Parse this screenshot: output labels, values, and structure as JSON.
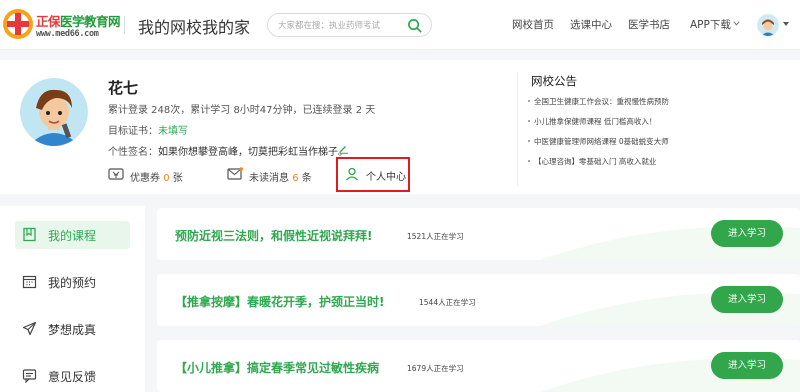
{
  "header": {
    "logo_brand_a": "正保",
    "logo_brand_b": "医学教育网",
    "logo_url": "www.med66.com",
    "site_title": "我的网校我的家",
    "search_placeholder": "大家都在搜：执业药师考试",
    "nav": [
      "网校首页",
      "选课中心",
      "医学书店",
      "APP下载"
    ]
  },
  "profile": {
    "name": "花七",
    "stats": "累计登录 248次，累计学习 8小时47分钟，已连续登录 2 天",
    "goal_label": "目标证书：",
    "goal_value": "未填写",
    "sign_label": "个性签名：",
    "sign_value": "如果你想攀登高峰，切莫把彩虹当作梯子。",
    "coupon_label": "优惠券",
    "coupon_count": "0",
    "coupon_unit": "张",
    "unread_label": "未读消息",
    "unread_count": "6",
    "unread_unit": "条",
    "user_center": "个人中心"
  },
  "notice": {
    "title": "网校公告",
    "items": [
      "全国卫生健康工作会议：重视慢性病预防",
      "小儿推拿保健师课程 低门槛高收入！",
      "中医健康管理师网络课程 0基础蜕变大师",
      "【心理咨询】零基础入门 高收入就业"
    ]
  },
  "sidebar": {
    "items": [
      {
        "label": "我的课程",
        "icon": "bookmark-icon"
      },
      {
        "label": "我的预约",
        "icon": "calendar-icon"
      },
      {
        "label": "梦想成真",
        "icon": "paper-plane-icon"
      },
      {
        "label": "意见反馈",
        "icon": "feedback-icon"
      }
    ]
  },
  "courses": [
    {
      "title": "预防近视三法则，和假性近视说拜拜!",
      "learners": "1521人正在学习",
      "button": "进入学习"
    },
    {
      "title": "【推拿按摩】春暖花开季，护颈正当时!",
      "learners": "1544人正在学习",
      "button": "进入学习"
    },
    {
      "title": "【小儿推拿】搞定春季常见过敏性疾病",
      "learners": "1679人正在学习",
      "button": "进入学习"
    }
  ],
  "colors": {
    "accent": "#31a64a",
    "highlight_box": "#e01c1c",
    "count": "#f08a1c"
  }
}
